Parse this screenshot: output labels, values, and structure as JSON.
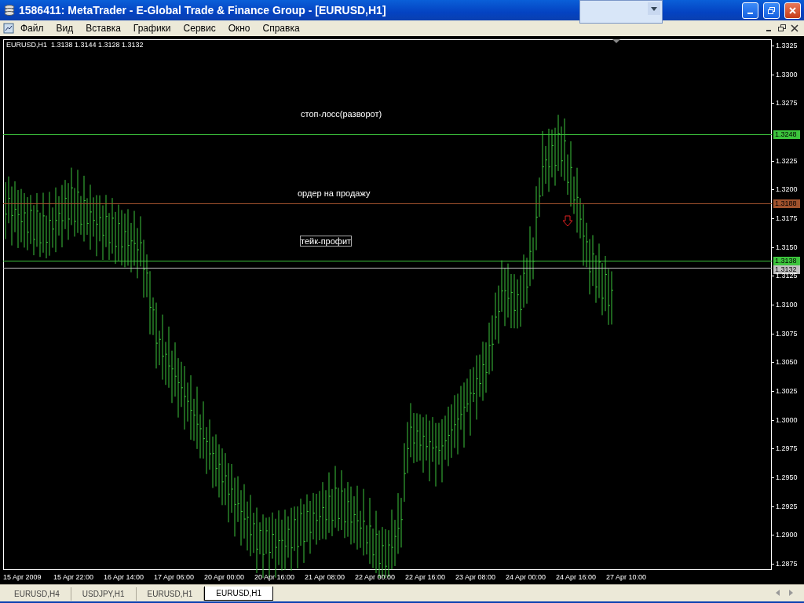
{
  "window": {
    "title": "1586411: MetaTrader - E-Global Trade & Finance Group - [EURUSD,H1]"
  },
  "menu": [
    "Файл",
    "Вид",
    "Вставка",
    "Графики",
    "Сервис",
    "Окно",
    "Справка"
  ],
  "chart": {
    "header": "EURUSD,H1  1.3138 1.3144 1.3128 1.3132",
    "y_axis": [
      "1.3325",
      "1.3300",
      "1.3275",
      "1.3225",
      "1.3200",
      "1.3175",
      "1.3150",
      "1.3125",
      "1.3100",
      "1.3075",
      "1.3050",
      "1.3025",
      "1.3000",
      "1.2975",
      "1.2950",
      "1.2925",
      "1.2900",
      "1.2875"
    ],
    "x_axis": [
      "15 Apr 2009",
      "15 Apr 22:00",
      "16 Apr 14:00",
      "17 Apr 06:00",
      "20 Apr 00:00",
      "20 Apr 16:00",
      "21 Apr 08:00",
      "22 Apr 00:00",
      "22 Apr 16:00",
      "23 Apr 08:00",
      "24 Apr 00:00",
      "24 Apr 16:00",
      "27 Apr 10:00"
    ],
    "levels": [
      {
        "price": "1.3248",
        "color": "#3cc43c"
      },
      {
        "price": "1.3188",
        "color": "#a0522d"
      },
      {
        "price": "1.3138",
        "color": "#3cc43c"
      },
      {
        "price": "1.3132",
        "color": "#c0c0c0"
      }
    ],
    "labels": [
      {
        "text": "стоп-лосс(разворот)",
        "selected": false
      },
      {
        "text": "ордер на продажу",
        "selected": false
      },
      {
        "text": "тейк-профит",
        "selected": true
      }
    ]
  },
  "tabs": [
    {
      "label": "EURUSD,H4",
      "selected": false
    },
    {
      "label": "USDJPY,H1",
      "selected": false
    },
    {
      "label": "EURUSD,H1",
      "selected": false
    },
    {
      "label": "EURUSD,H1",
      "selected": true
    }
  ]
}
